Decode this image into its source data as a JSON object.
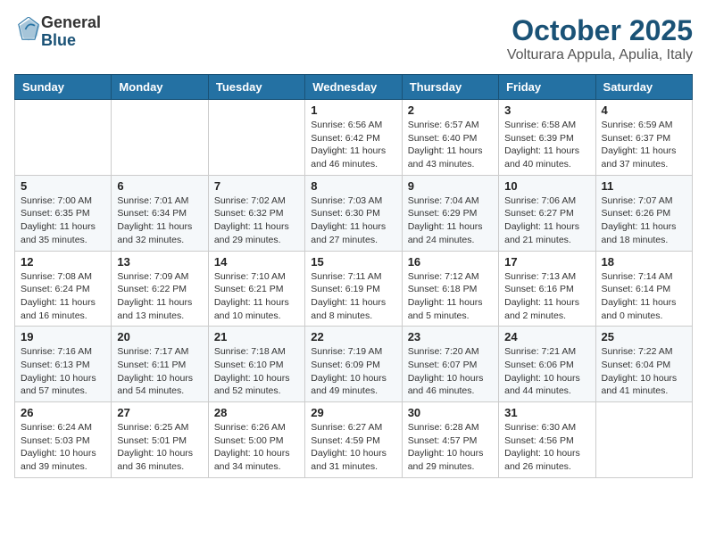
{
  "header": {
    "logo_general": "General",
    "logo_blue": "Blue",
    "month_title": "October 2025",
    "location": "Volturara Appula, Apulia, Italy"
  },
  "weekdays": [
    "Sunday",
    "Monday",
    "Tuesday",
    "Wednesday",
    "Thursday",
    "Friday",
    "Saturday"
  ],
  "weeks": [
    [
      {
        "day": "",
        "info": ""
      },
      {
        "day": "",
        "info": ""
      },
      {
        "day": "",
        "info": ""
      },
      {
        "day": "1",
        "info": "Sunrise: 6:56 AM\nSunset: 6:42 PM\nDaylight: 11 hours and 46 minutes."
      },
      {
        "day": "2",
        "info": "Sunrise: 6:57 AM\nSunset: 6:40 PM\nDaylight: 11 hours and 43 minutes."
      },
      {
        "day": "3",
        "info": "Sunrise: 6:58 AM\nSunset: 6:39 PM\nDaylight: 11 hours and 40 minutes."
      },
      {
        "day": "4",
        "info": "Sunrise: 6:59 AM\nSunset: 6:37 PM\nDaylight: 11 hours and 37 minutes."
      }
    ],
    [
      {
        "day": "5",
        "info": "Sunrise: 7:00 AM\nSunset: 6:35 PM\nDaylight: 11 hours and 35 minutes."
      },
      {
        "day": "6",
        "info": "Sunrise: 7:01 AM\nSunset: 6:34 PM\nDaylight: 11 hours and 32 minutes."
      },
      {
        "day": "7",
        "info": "Sunrise: 7:02 AM\nSunset: 6:32 PM\nDaylight: 11 hours and 29 minutes."
      },
      {
        "day": "8",
        "info": "Sunrise: 7:03 AM\nSunset: 6:30 PM\nDaylight: 11 hours and 27 minutes."
      },
      {
        "day": "9",
        "info": "Sunrise: 7:04 AM\nSunset: 6:29 PM\nDaylight: 11 hours and 24 minutes."
      },
      {
        "day": "10",
        "info": "Sunrise: 7:06 AM\nSunset: 6:27 PM\nDaylight: 11 hours and 21 minutes."
      },
      {
        "day": "11",
        "info": "Sunrise: 7:07 AM\nSunset: 6:26 PM\nDaylight: 11 hours and 18 minutes."
      }
    ],
    [
      {
        "day": "12",
        "info": "Sunrise: 7:08 AM\nSunset: 6:24 PM\nDaylight: 11 hours and 16 minutes."
      },
      {
        "day": "13",
        "info": "Sunrise: 7:09 AM\nSunset: 6:22 PM\nDaylight: 11 hours and 13 minutes."
      },
      {
        "day": "14",
        "info": "Sunrise: 7:10 AM\nSunset: 6:21 PM\nDaylight: 11 hours and 10 minutes."
      },
      {
        "day": "15",
        "info": "Sunrise: 7:11 AM\nSunset: 6:19 PM\nDaylight: 11 hours and 8 minutes."
      },
      {
        "day": "16",
        "info": "Sunrise: 7:12 AM\nSunset: 6:18 PM\nDaylight: 11 hours and 5 minutes."
      },
      {
        "day": "17",
        "info": "Sunrise: 7:13 AM\nSunset: 6:16 PM\nDaylight: 11 hours and 2 minutes."
      },
      {
        "day": "18",
        "info": "Sunrise: 7:14 AM\nSunset: 6:14 PM\nDaylight: 11 hours and 0 minutes."
      }
    ],
    [
      {
        "day": "19",
        "info": "Sunrise: 7:16 AM\nSunset: 6:13 PM\nDaylight: 10 hours and 57 minutes."
      },
      {
        "day": "20",
        "info": "Sunrise: 7:17 AM\nSunset: 6:11 PM\nDaylight: 10 hours and 54 minutes."
      },
      {
        "day": "21",
        "info": "Sunrise: 7:18 AM\nSunset: 6:10 PM\nDaylight: 10 hours and 52 minutes."
      },
      {
        "day": "22",
        "info": "Sunrise: 7:19 AM\nSunset: 6:09 PM\nDaylight: 10 hours and 49 minutes."
      },
      {
        "day": "23",
        "info": "Sunrise: 7:20 AM\nSunset: 6:07 PM\nDaylight: 10 hours and 46 minutes."
      },
      {
        "day": "24",
        "info": "Sunrise: 7:21 AM\nSunset: 6:06 PM\nDaylight: 10 hours and 44 minutes."
      },
      {
        "day": "25",
        "info": "Sunrise: 7:22 AM\nSunset: 6:04 PM\nDaylight: 10 hours and 41 minutes."
      }
    ],
    [
      {
        "day": "26",
        "info": "Sunrise: 6:24 AM\nSunset: 5:03 PM\nDaylight: 10 hours and 39 minutes."
      },
      {
        "day": "27",
        "info": "Sunrise: 6:25 AM\nSunset: 5:01 PM\nDaylight: 10 hours and 36 minutes."
      },
      {
        "day": "28",
        "info": "Sunrise: 6:26 AM\nSunset: 5:00 PM\nDaylight: 10 hours and 34 minutes."
      },
      {
        "day": "29",
        "info": "Sunrise: 6:27 AM\nSunset: 4:59 PM\nDaylight: 10 hours and 31 minutes."
      },
      {
        "day": "30",
        "info": "Sunrise: 6:28 AM\nSunset: 4:57 PM\nDaylight: 10 hours and 29 minutes."
      },
      {
        "day": "31",
        "info": "Sunrise: 6:30 AM\nSunset: 4:56 PM\nDaylight: 10 hours and 26 minutes."
      },
      {
        "day": "",
        "info": ""
      }
    ]
  ]
}
